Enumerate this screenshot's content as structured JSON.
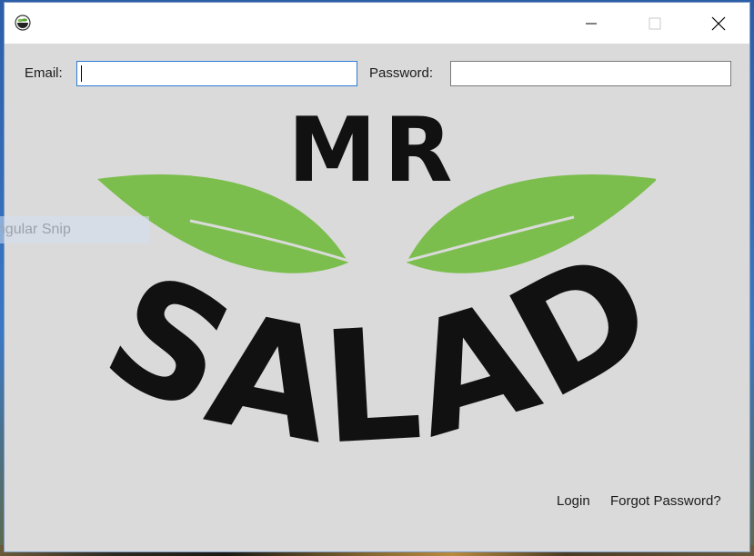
{
  "window": {
    "title": "",
    "app_icon": "salad-bowl-icon"
  },
  "titlebar": {
    "minimize_icon": "minimize-icon",
    "maximize_icon": "maximize-icon",
    "close_icon": "close-icon"
  },
  "login_form": {
    "email_label": "Email:",
    "email_value": "",
    "password_label": "Password:",
    "password_value": ""
  },
  "logo": {
    "top_text": "MR",
    "bottom_text": "SALAD",
    "leaf_color": "#7bbe4d",
    "text_color": "#111111"
  },
  "links": {
    "login": "Login",
    "forgot_password": "Forgot Password?"
  },
  "background_overlay": {
    "text": "angular Snip"
  }
}
